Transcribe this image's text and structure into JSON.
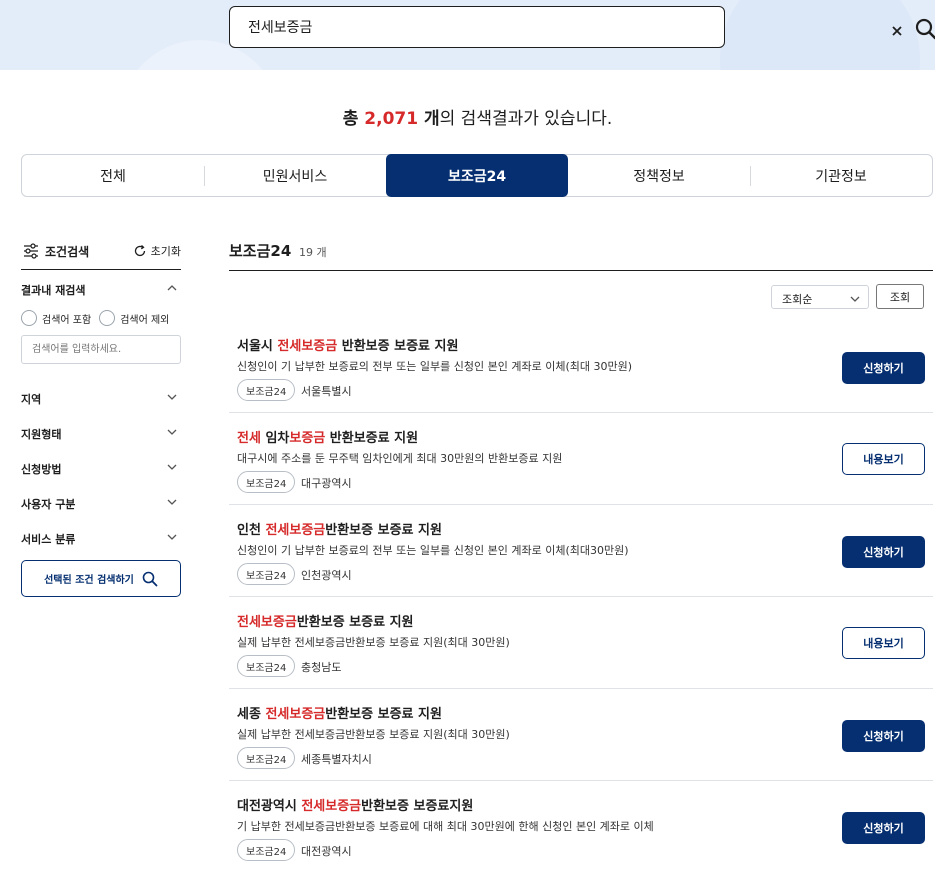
{
  "search": {
    "value": "전세보증금"
  },
  "summary": {
    "prefix": "총 ",
    "count": "2,071",
    "unit": " 개",
    "suffix": "의 검색결과가 있습니다."
  },
  "tabs": [
    {
      "label": "전체",
      "active": false
    },
    {
      "label": "민원서비스",
      "active": false
    },
    {
      "label": "보조금24",
      "active": true
    },
    {
      "label": "정책정보",
      "active": false
    },
    {
      "label": "기관정보",
      "active": false
    }
  ],
  "sidebar": {
    "title": "조건검색",
    "reset": "초기화",
    "refine": "결과내 재검색",
    "include": "검색어 포함",
    "exclude": "검색어 제외",
    "placeholder": "검색어를 입력하세요.",
    "filters": [
      "지역",
      "지원형태",
      "신청방법",
      "사용자 구분",
      "서비스 분류"
    ],
    "submit": "선택된 조건 검색하기"
  },
  "main": {
    "title": "보조금24",
    "count": "19 개",
    "sort": "조회순",
    "sort_button": "조회"
  },
  "items": [
    {
      "pre": "서울시 ",
      "hl": "전세보증금",
      "post": " 반환보증 보증료 지원",
      "desc": "신청인이 기 납부한 보증료의 전부 또는 일부를 신청인 본인 계좌로 이체(최대 30만원)",
      "badge": "보조금24",
      "region": "서울특별시",
      "button": "신청하기",
      "type": "apply"
    },
    {
      "pre": "",
      "hl": "전세",
      "post": " 임차",
      "hl2": "보증금",
      "post2": " 반환보증료 지원",
      "desc": "대구시에 주소를 둔 무주택 임차인에게 최대 30만원의 반환보증료 지원",
      "badge": "보조금24",
      "region": "대구광역시",
      "button": "내용보기",
      "type": "view"
    },
    {
      "pre": "인천 ",
      "hl": "전세보증금",
      "post": "반환보증 보증료 지원",
      "desc": "신청인이 기 납부한 보증료의 전부 또는 일부를 신청인 본인 계좌로 이체(최대30만원)",
      "badge": "보조금24",
      "region": "인천광역시",
      "button": "신청하기",
      "type": "apply"
    },
    {
      "pre": "",
      "hl": "전세보증금",
      "post": "반환보증 보증료 지원",
      "desc": "실제 납부한 전세보증금반환보증 보증료 지원(최대 30만원)",
      "badge": "보조금24",
      "region": "충청남도",
      "button": "내용보기",
      "type": "view"
    },
    {
      "pre": "세종 ",
      "hl": "전세보증금",
      "post": "반환보증 보증료 지원",
      "desc": "실제 납부한 전세보증금반환보증 보증료 지원(최대 30만원)",
      "badge": "보조금24",
      "region": "세종특별자치시",
      "button": "신청하기",
      "type": "apply"
    },
    {
      "pre": "대전광역시 ",
      "hl": "전세보증금",
      "post": "반환보증 보증료지원",
      "desc": "기 납부한 전세보증금반환보증 보증료에 대해 최대 30만원에 한해 신청인 본인 계좌로 이체",
      "badge": "보조금24",
      "region": "대전광역시",
      "button": "신청하기",
      "type": "apply"
    }
  ]
}
